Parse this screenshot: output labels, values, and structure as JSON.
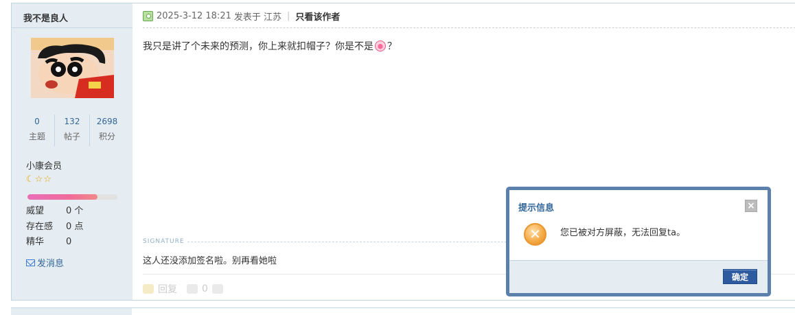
{
  "author": {
    "name": "我不是良人",
    "stats": [
      {
        "value": "0",
        "label": "主题"
      },
      {
        "value": "132",
        "label": "帖子"
      },
      {
        "value": "2698",
        "label": "积分"
      }
    ],
    "group": "小康会员",
    "level_progress": 0.78,
    "info": [
      {
        "key": "威望",
        "value": "0 个"
      },
      {
        "key": "存在感",
        "value": "0 点"
      },
      {
        "key": "精华",
        "value": "0"
      }
    ],
    "send_message": "发消息"
  },
  "post": {
    "timestamp": "2025-3-12 18:21",
    "posted_in": "发表于 江苏",
    "only_author": "只看该作者",
    "body_before": "我只是讲了个未来的预测，你上来就扣帽子？你是不是",
    "body_after": "？",
    "signature_label": "SIGNATURE",
    "signature": "这人还没添加签名啦。别再看她啦",
    "reply_label": "回复",
    "like_count": "0"
  },
  "dialog": {
    "title": "提示信息",
    "message": "您已被对方屏蔽，无法回复ta。",
    "ok_label": "确定",
    "close_glyph": "×"
  },
  "icons": {
    "online": "online-status-icon",
    "emoji": "clown-emoji-icon",
    "error": "error-x-icon",
    "mail": "envelope-icon"
  },
  "colors": {
    "sidebar_bg": "#e5edf2",
    "link": "#336699",
    "dialog_border": "#5b80ab",
    "ok_button": "#2e5b9f"
  }
}
